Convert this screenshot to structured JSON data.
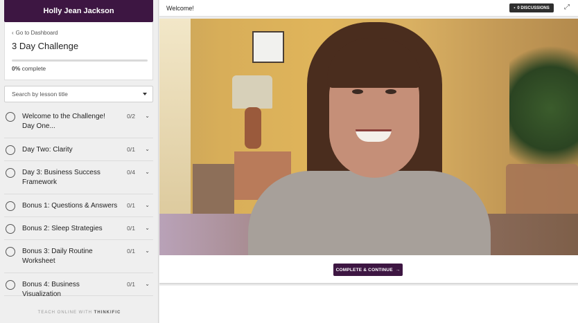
{
  "course": {
    "author": "Holly Jean Jackson",
    "dashboard_link": "Go to Dashboard",
    "title": "3 Day Challenge",
    "progress_percent": 0,
    "progress_value": "0%",
    "progress_suffix": "complete"
  },
  "search": {
    "placeholder": "Search by lesson title"
  },
  "lessons": [
    {
      "title": "Welcome to the Challenge! Day One...",
      "count": "0/2"
    },
    {
      "title": "Day Two: Clarity",
      "count": "0/1"
    },
    {
      "title": "Day 3: Business Success Framework",
      "count": "0/4"
    },
    {
      "title": "Bonus 1: Questions & Answers",
      "count": "0/1"
    },
    {
      "title": "Bonus 2: Sleep Strategies",
      "count": "0/1"
    },
    {
      "title": "Bonus 3: Daily Routine Worksheet",
      "count": "0/1"
    },
    {
      "title": "Bonus 4: Business Visualization",
      "count": "0/1"
    }
  ],
  "footer": {
    "prefix": "TEACH ONLINE WITH",
    "brand": "THINKIFIC"
  },
  "topbar": {
    "lesson_title": "Welcome!",
    "discussions_label": "0 DISCUSSIONS"
  },
  "actions": {
    "complete_label": "COMPLETE & CONTINUE",
    "complete_arrow": "→"
  },
  "colors": {
    "brand": "#3d1642",
    "dark_button": "#2e2e2e"
  },
  "icons": {
    "back": "chevron-left-icon",
    "expand": "expand-icon",
    "discussion": "comment-icon",
    "lesson_status": "circle-icon",
    "lesson_toggle": "chevron-down-icon"
  }
}
